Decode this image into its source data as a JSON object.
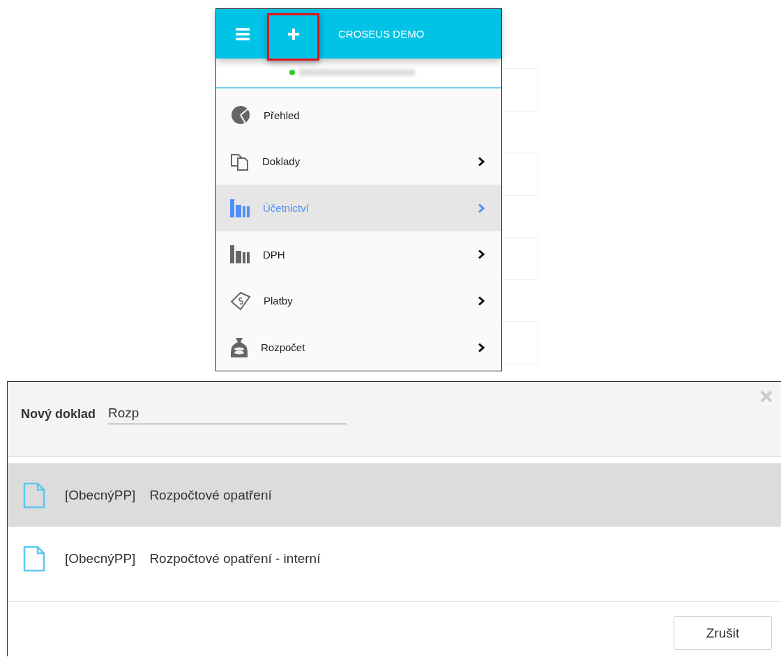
{
  "menu": {
    "title": "CROSEUS DEMO",
    "add_button_highlighted": true,
    "user_online": true,
    "items": [
      {
        "label": "Přehled",
        "selected": false,
        "has_submenu": false
      },
      {
        "label": "Doklady",
        "selected": false,
        "has_submenu": true
      },
      {
        "label": "Účetnictví",
        "selected": true,
        "has_submenu": true
      },
      {
        "label": "DPH",
        "selected": false,
        "has_submenu": true
      },
      {
        "label": "Platby",
        "selected": false,
        "has_submenu": true
      },
      {
        "label": "Rozpočet",
        "selected": false,
        "has_submenu": true
      }
    ]
  },
  "dialog": {
    "title": "Nový doklad",
    "value": "Rozp",
    "options": [
      {
        "prefix": "[ObecnýPP]",
        "name": "Rozpočtové opatření",
        "selected": true
      },
      {
        "prefix": "[ObecnýPP]",
        "name": "Rozpočtové opatření - interní",
        "selected": false
      }
    ],
    "buttons": [
      "Zrušit"
    ]
  }
}
